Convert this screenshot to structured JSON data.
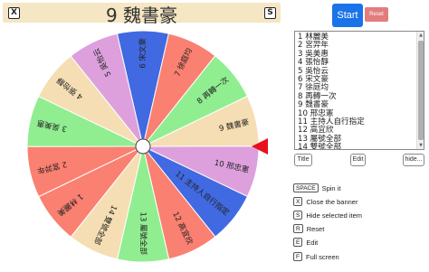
{
  "banner": {
    "title": "9 魏書豪",
    "close_key": "X",
    "fullscreen_key": "S"
  },
  "controls": {
    "start_label": "Start",
    "reset_label": "Reset"
  },
  "names": [
    "1 林麗美",
    "2 宮羿年",
    "3 吳美惠",
    "4 張怡靜",
    "5 吳怡云",
    "6 宋文豪",
    "7 徐庭均",
    "8 再轉一次",
    "9 魏書豪",
    "10 邢忠憲",
    "11 主持人自行指定",
    "12 高宜欣",
    "13 屬號全部",
    "14 雙號全部"
  ],
  "buttons": {
    "title": "Title",
    "edit": "Edit",
    "hide": "hide..."
  },
  "shortcuts": [
    {
      "key": "SPACE",
      "label": "Spin it"
    },
    {
      "key": "X",
      "label": "Close the banner"
    },
    {
      "key": "S",
      "label": "Hide selected item"
    },
    {
      "key": "R",
      "label": "Reset"
    },
    {
      "key": "E",
      "label": "Edit"
    },
    {
      "key": "F",
      "label": "Full screen"
    }
  ],
  "wheel": {
    "segments": [
      {
        "label": "9 魏書豪",
        "color": "#f5deb3"
      },
      {
        "label": "10 邢忠憲",
        "color": "#dda0dd"
      },
      {
        "label": "11 主持人自行指定",
        "color": "#4169e1"
      },
      {
        "label": "12 高宜欣",
        "color": "#fa8072"
      },
      {
        "label": "13 屬號全部",
        "color": "#90ee90"
      },
      {
        "label": "14 雙號全部",
        "color": "#f5deb3"
      },
      {
        "label": "1 林麗美",
        "color": "#fa8072"
      },
      {
        "label": "2 宮羿年",
        "color": "#fa8072"
      },
      {
        "label": "3 吳美惠",
        "color": "#90ee90"
      },
      {
        "label": "4 張怡靜",
        "color": "#f5deb3"
      },
      {
        "label": "5 吳怡云",
        "color": "#dda0dd"
      },
      {
        "label": "6 宋文豪",
        "color": "#4169e1"
      },
      {
        "label": "7 徐庭均",
        "color": "#fa8072"
      },
      {
        "label": "8 再轉一次",
        "color": "#90ee90"
      }
    ],
    "pointer_color": "#e8101a"
  }
}
